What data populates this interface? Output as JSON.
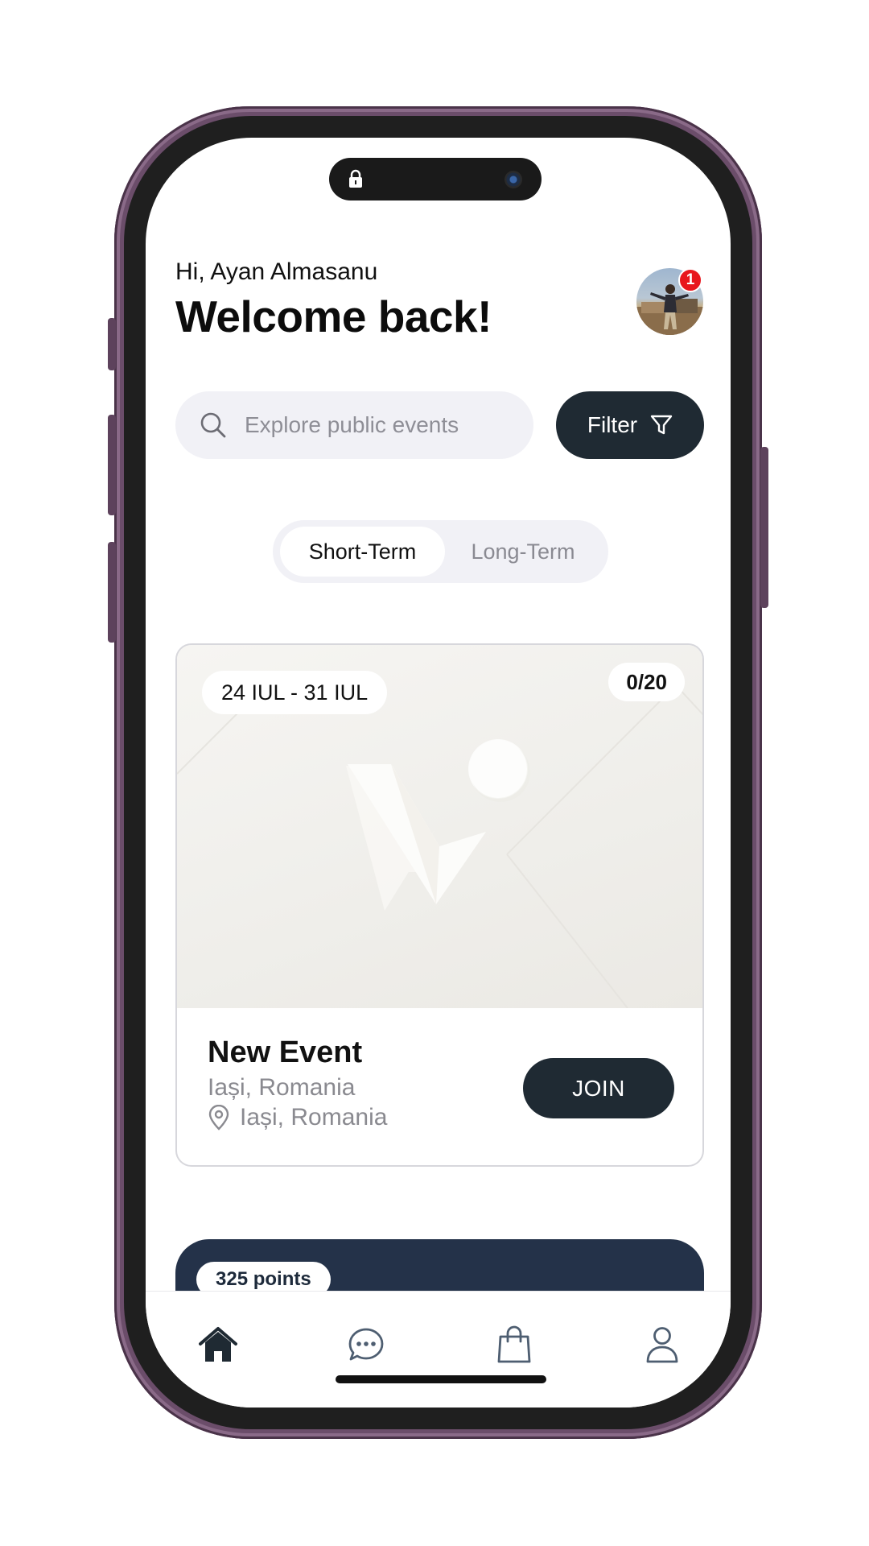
{
  "header": {
    "greeting": "Hi, Ayan Almasanu",
    "title": "Welcome back!",
    "notification_count": "1"
  },
  "search": {
    "placeholder": "Explore public events",
    "value": ""
  },
  "filter": {
    "label": "Filter"
  },
  "segments": {
    "items": [
      {
        "label": "Short-Term",
        "selected": true
      },
      {
        "label": "Long-Term",
        "selected": false
      }
    ]
  },
  "event": {
    "date_range": "24 IUL - 31 IUL",
    "capacity": "0/20",
    "title": "New Event",
    "city": "Iași, Romania",
    "location": "Iași, Romania",
    "join_label": "JOIN"
  },
  "points": {
    "label": "325 points"
  },
  "tabs": {
    "items": [
      {
        "icon": "home-icon",
        "active": true
      },
      {
        "icon": "chat-icon",
        "active": false
      },
      {
        "icon": "shopping-bag-icon",
        "active": false
      },
      {
        "icon": "profile-icon",
        "active": false
      }
    ]
  },
  "colors": {
    "dark_accent": "#1f2a33",
    "navy_card": "#243249",
    "badge_red": "#e8161d",
    "field_bg": "#f1f1f6"
  }
}
